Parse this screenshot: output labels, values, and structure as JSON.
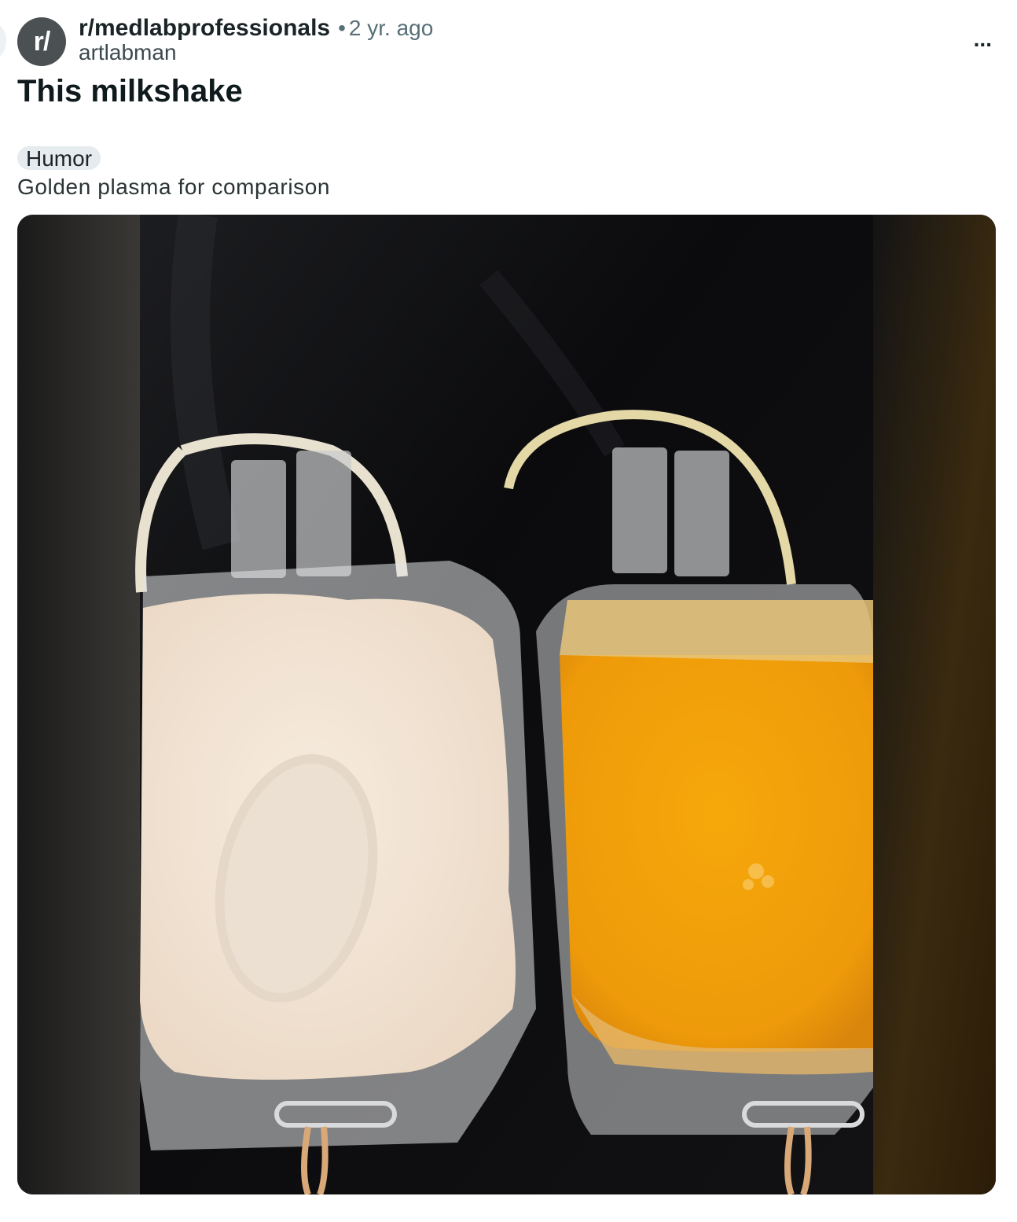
{
  "post": {
    "avatar_text": "r/",
    "subreddit": "r/medlabprofessionals",
    "separator": "•",
    "time": "2 yr. ago",
    "author": "artlabman",
    "more_icon": "more-horizontal-icon",
    "more_label": "...",
    "title": "This milkshake",
    "flair": "Humor",
    "body": "Golden plasma for comparison"
  },
  "media": {
    "alt_subject": "lipemic plasma bag beside golden plasma bag"
  },
  "colors": {
    "avatar_bg": "#4b5153",
    "flair_bg": "#e5ebee",
    "muted_text": "#576f76",
    "milky_plasma": "#f3e6d6",
    "golden_plasma": "#f4a60c"
  }
}
